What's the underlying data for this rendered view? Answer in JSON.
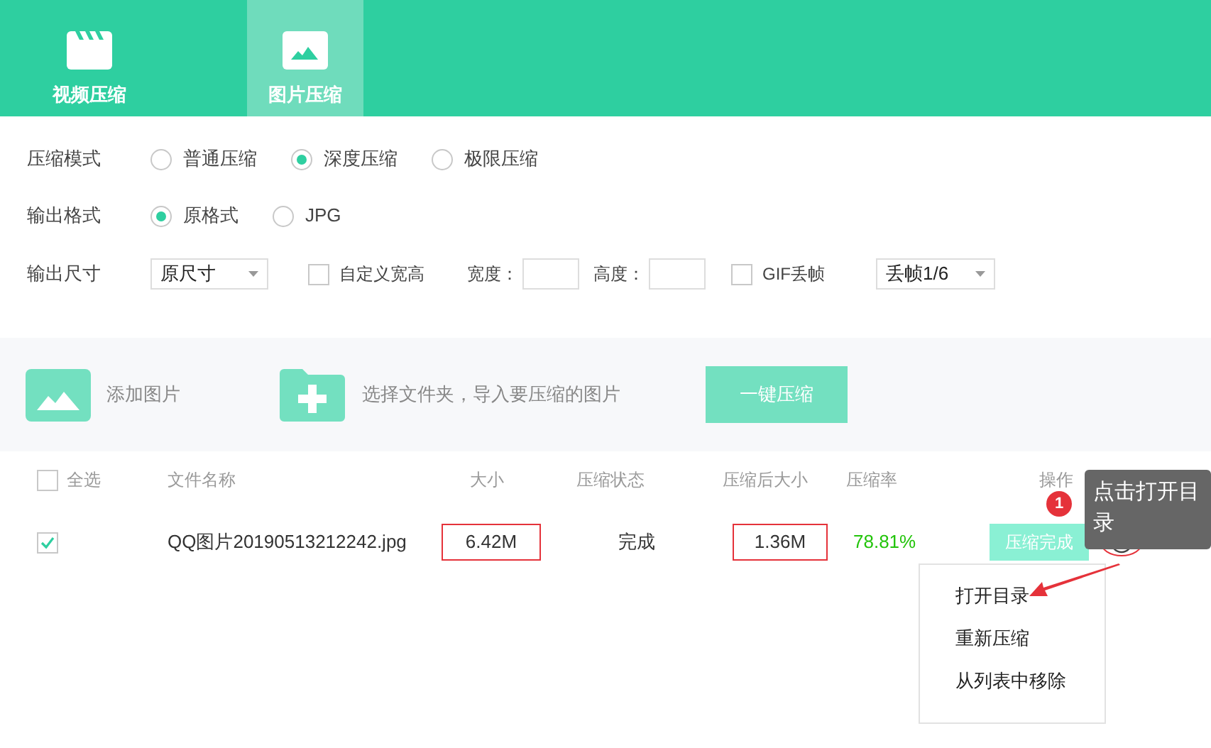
{
  "tabs": [
    {
      "label": "视频压缩",
      "kind": "video",
      "selected": false
    },
    {
      "label": "图片压缩",
      "kind": "image",
      "selected": true
    }
  ],
  "options": {
    "mode": {
      "label": "压缩模式",
      "choices": [
        {
          "label": "普通压缩",
          "selected": false
        },
        {
          "label": "深度压缩",
          "selected": true
        },
        {
          "label": "极限压缩",
          "selected": false
        }
      ]
    },
    "format": {
      "label": "输出格式",
      "choices": [
        {
          "label": "原格式",
          "selected": true
        },
        {
          "label": "JPG",
          "selected": false
        }
      ]
    },
    "size": {
      "label": "输出尺寸",
      "select_value": "原尺寸",
      "custom": {
        "label": "自定义宽高",
        "checked": false
      },
      "width_label": "宽度：",
      "height_label": "高度：",
      "gif": {
        "label": "GIF丢帧",
        "checked": false
      },
      "gif_select_value": "丢帧1/6"
    }
  },
  "toolbar": {
    "add_image": "添加图片",
    "add_folder": "选择文件夹，导入要压缩的图片",
    "compress_all": "一键压缩"
  },
  "table": {
    "select_all": {
      "label": "全选",
      "checked": false
    },
    "columns": [
      "文件名称",
      "大小",
      "压缩状态",
      "压缩后大小",
      "压缩率",
      "操作"
    ],
    "rows": [
      {
        "checked": true,
        "name": "QQ图片20190513212242.jpg",
        "size": {
          "text": "6.42M",
          "highlighted": true
        },
        "status": "完成",
        "compressed_size": {
          "text": "1.36M",
          "highlighted": true
        },
        "rate": "78.81%",
        "action": "压缩完成"
      }
    ]
  },
  "context_menu": {
    "items": [
      "打开目录",
      "重新压缩",
      "从列表中移除"
    ]
  },
  "annotation": {
    "badge": "1",
    "tooltip": "点击打开目录"
  }
}
